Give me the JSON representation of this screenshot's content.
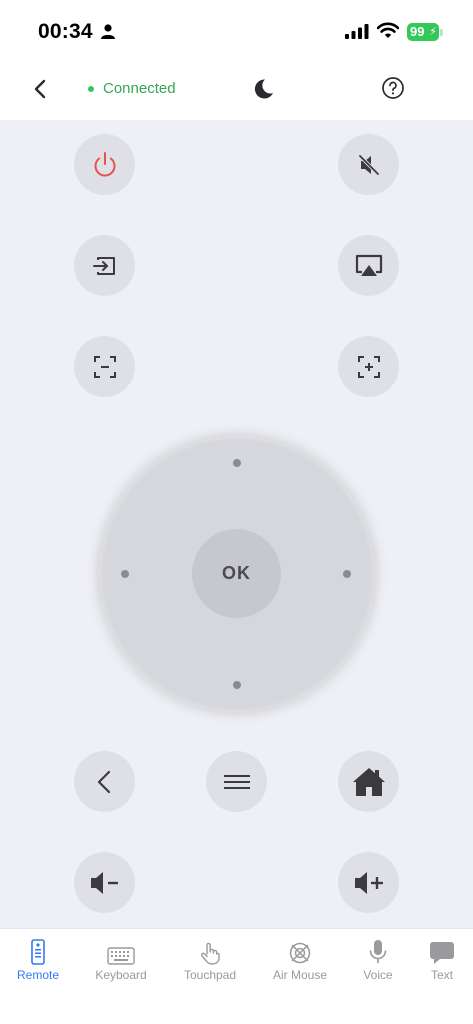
{
  "status_bar": {
    "time": "00:34",
    "battery": "99"
  },
  "header": {
    "connection_status": "Connected"
  },
  "remote": {
    "ok_label": "OK"
  },
  "tabs": [
    {
      "label": "Remote",
      "icon": "remote-icon",
      "active": true
    },
    {
      "label": "Keyboard",
      "icon": "keyboard-icon",
      "active": false
    },
    {
      "label": "Touchpad",
      "icon": "touchpad-icon",
      "active": false
    },
    {
      "label": "Air Mouse",
      "icon": "air-mouse-icon",
      "active": false
    },
    {
      "label": "Voice",
      "icon": "microphone-icon",
      "active": false
    },
    {
      "label": "Text",
      "icon": "chat-bubble-icon",
      "active": false
    }
  ],
  "colors": {
    "accent": "#3478f6",
    "connected": "#34c759",
    "power": "#e5534b",
    "remote_background": "#eff0f5",
    "button": "#dfe0e5"
  }
}
